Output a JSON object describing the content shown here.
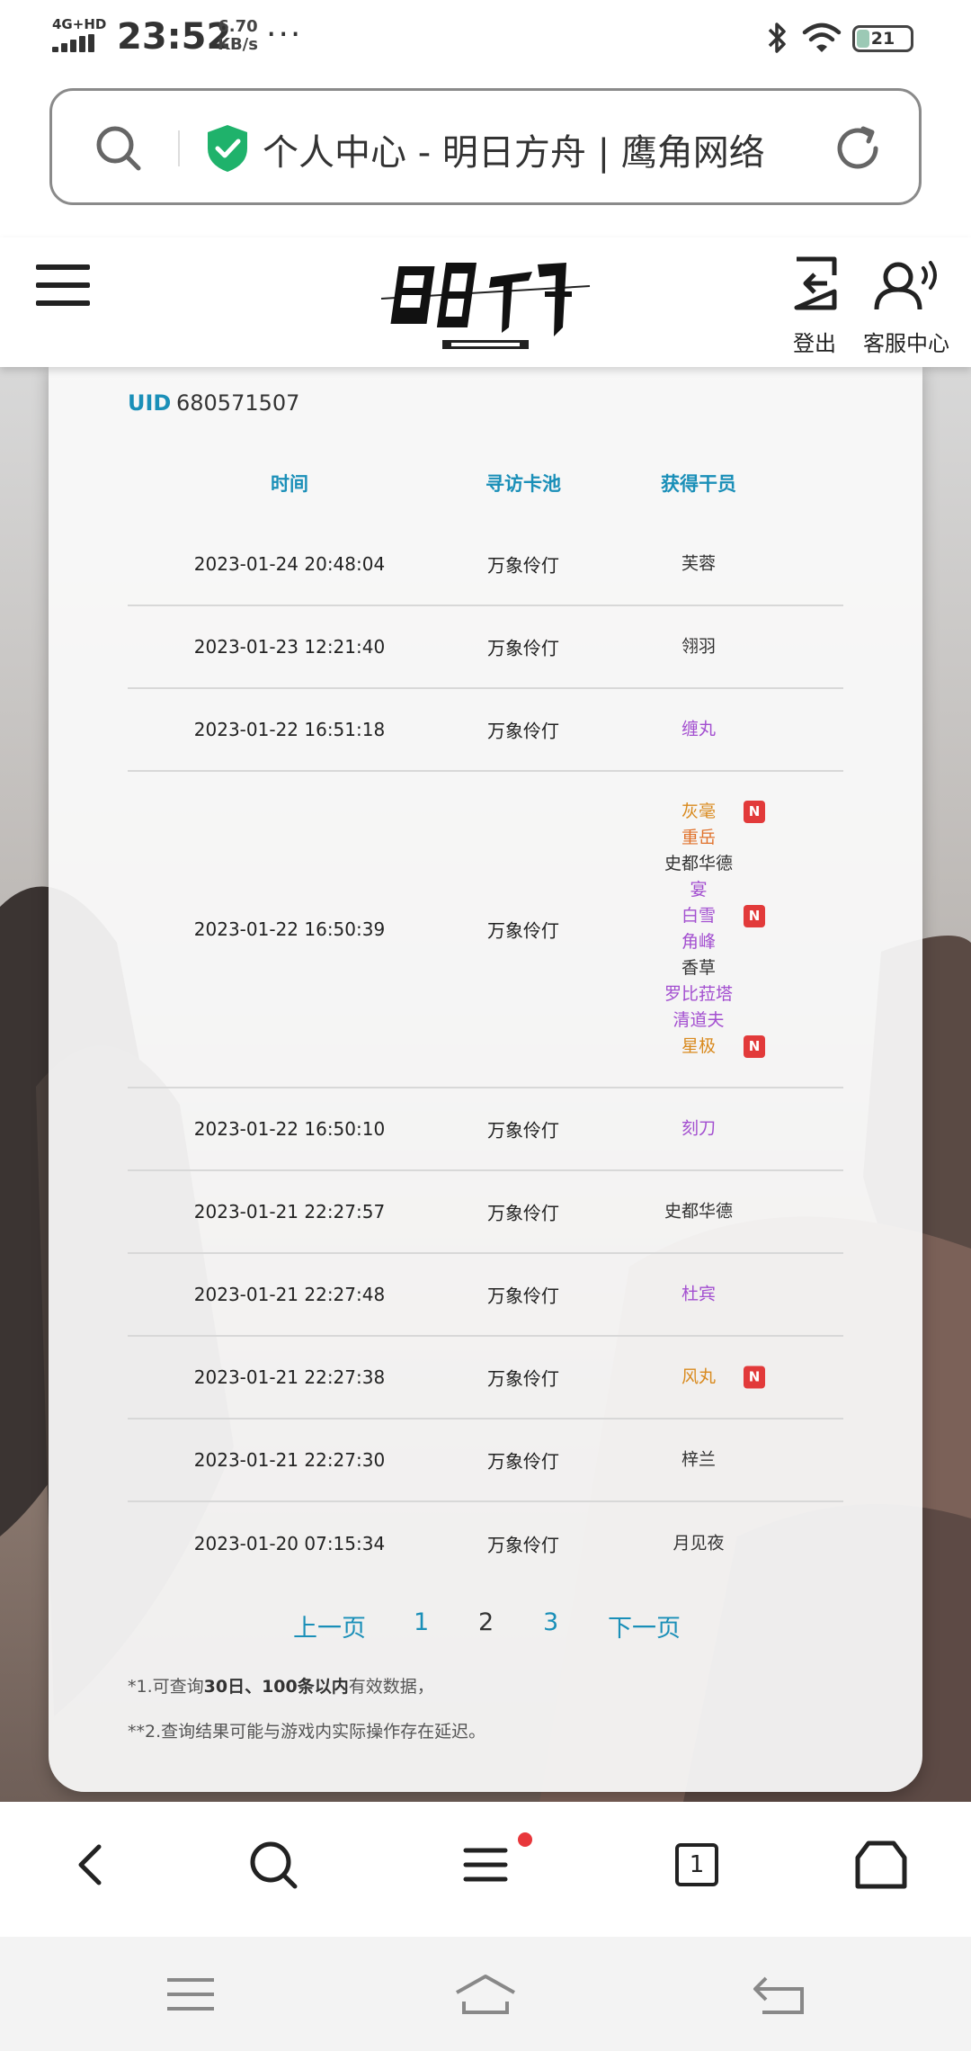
{
  "status_bar": {
    "network": "4G+HD",
    "time": "23:52",
    "speed_value": "6.70",
    "speed_unit": "KB/s",
    "more": "···",
    "battery": "21"
  },
  "browser": {
    "page_title": "个人中心 - 明日方舟 | 鹰角网络"
  },
  "site_header": {
    "logout_label": "登出",
    "support_label": "客服中心"
  },
  "record": {
    "uid_label": "UID",
    "uid_value": "680571507",
    "columns": [
      "时间",
      "寻访卡池",
      "获得干员"
    ],
    "rows": [
      {
        "time": "2023-01-24 20:48:04",
        "pool": "万象伶仃",
        "operators": [
          {
            "name": "芙蓉",
            "rarity": 3,
            "new": false
          }
        ]
      },
      {
        "time": "2023-01-23 12:21:40",
        "pool": "万象伶仃",
        "operators": [
          {
            "name": "翎羽",
            "rarity": 3,
            "new": false
          }
        ]
      },
      {
        "time": "2023-01-22 16:51:18",
        "pool": "万象伶仃",
        "operators": [
          {
            "name": "缠丸",
            "rarity": 4,
            "new": false
          }
        ]
      },
      {
        "time": "2023-01-22 16:50:39",
        "pool": "万象伶仃",
        "operators": [
          {
            "name": "灰毫",
            "rarity": 5,
            "new": true
          },
          {
            "name": "重岳",
            "rarity": 6,
            "new": false
          },
          {
            "name": "史都华德",
            "rarity": 3,
            "new": false
          },
          {
            "name": "宴",
            "rarity": 4,
            "new": false
          },
          {
            "name": "白雪",
            "rarity": 4,
            "new": true
          },
          {
            "name": "角峰",
            "rarity": 4,
            "new": false
          },
          {
            "name": "香草",
            "rarity": 3,
            "new": false
          },
          {
            "name": "罗比菈塔",
            "rarity": 4,
            "new": false
          },
          {
            "name": "清道夫",
            "rarity": 4,
            "new": false
          },
          {
            "name": "星极",
            "rarity": 5,
            "new": true
          }
        ]
      },
      {
        "time": "2023-01-22 16:50:10",
        "pool": "万象伶仃",
        "operators": [
          {
            "name": "刻刀",
            "rarity": 4,
            "new": false
          }
        ]
      },
      {
        "time": "2023-01-21 22:27:57",
        "pool": "万象伶仃",
        "operators": [
          {
            "name": "史都华德",
            "rarity": 3,
            "new": false
          }
        ]
      },
      {
        "time": "2023-01-21 22:27:48",
        "pool": "万象伶仃",
        "operators": [
          {
            "name": "杜宾",
            "rarity": 4,
            "new": false
          }
        ]
      },
      {
        "time": "2023-01-21 22:27:38",
        "pool": "万象伶仃",
        "operators": [
          {
            "name": "风丸",
            "rarity": 5,
            "new": true
          }
        ]
      },
      {
        "time": "2023-01-21 22:27:30",
        "pool": "万象伶仃",
        "operators": [
          {
            "name": "梓兰",
            "rarity": 3,
            "new": false
          }
        ]
      },
      {
        "time": "2023-01-20 07:15:34",
        "pool": "万象伶仃",
        "operators": [
          {
            "name": "月见夜",
            "rarity": 3,
            "new": false
          }
        ]
      }
    ],
    "new_badge": "N",
    "rarity_colors": {
      "3": "#333333",
      "4": "#a34fd0",
      "5": "#d98a1e",
      "6": "#e0712a"
    }
  },
  "pagination": {
    "prev": "上一页",
    "pages": [
      "1",
      "2",
      "3"
    ],
    "current": "2",
    "next": "下一页"
  },
  "notes": {
    "note1_prefix": "*1.可查询",
    "note1_bold": "30日、100条以内",
    "note1_suffix": "有效数据，",
    "note2": "**2.查询结果可能与游戏内实际操作存在延迟。"
  },
  "bottom_nav": {
    "tab_count": "1",
    "icons": [
      "back-icon",
      "search-icon",
      "menu-icon",
      "tabs-icon",
      "home-icon"
    ]
  }
}
